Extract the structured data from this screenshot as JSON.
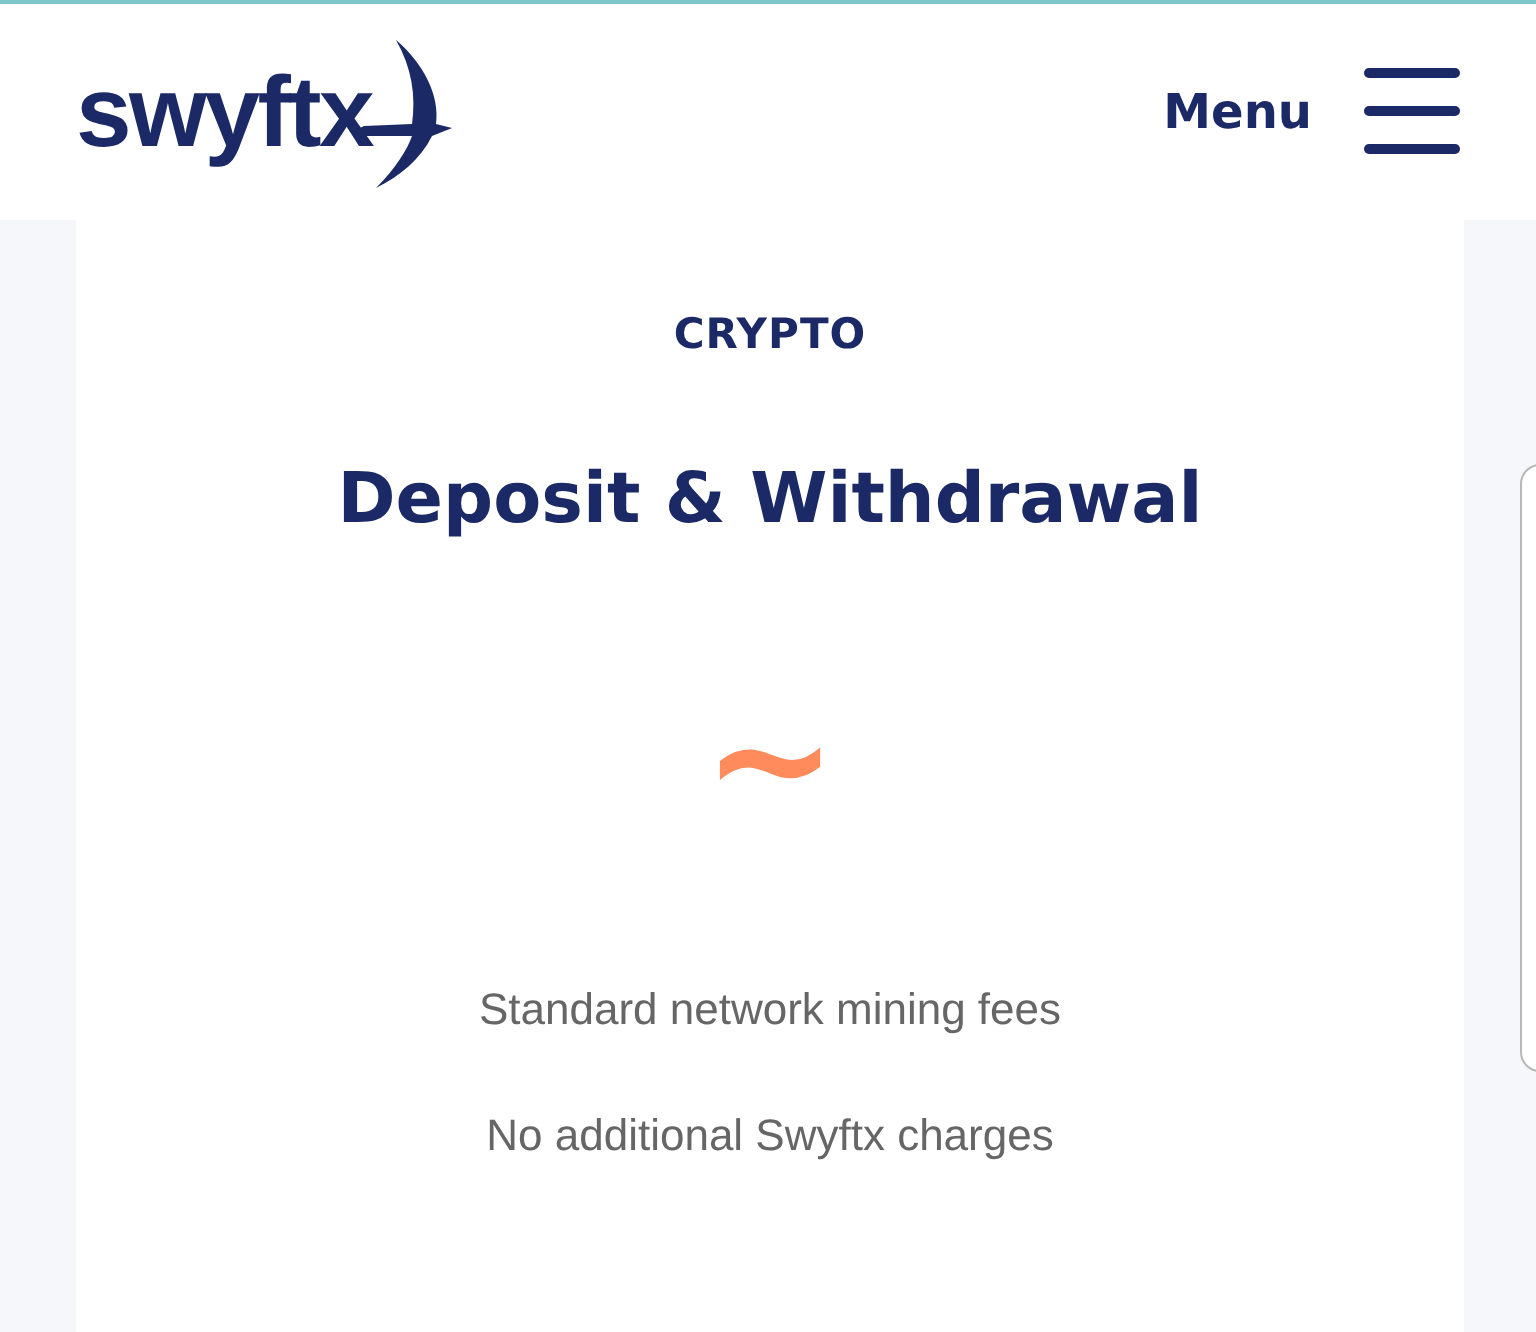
{
  "header": {
    "logo": "swyftx",
    "menu_label": "Menu"
  },
  "card": {
    "category": "CRYPTO",
    "title": "Deposit & Withdrawal",
    "symbol": "~",
    "lines": [
      "Standard network mining fees",
      "No additional Swyftx charges"
    ]
  }
}
